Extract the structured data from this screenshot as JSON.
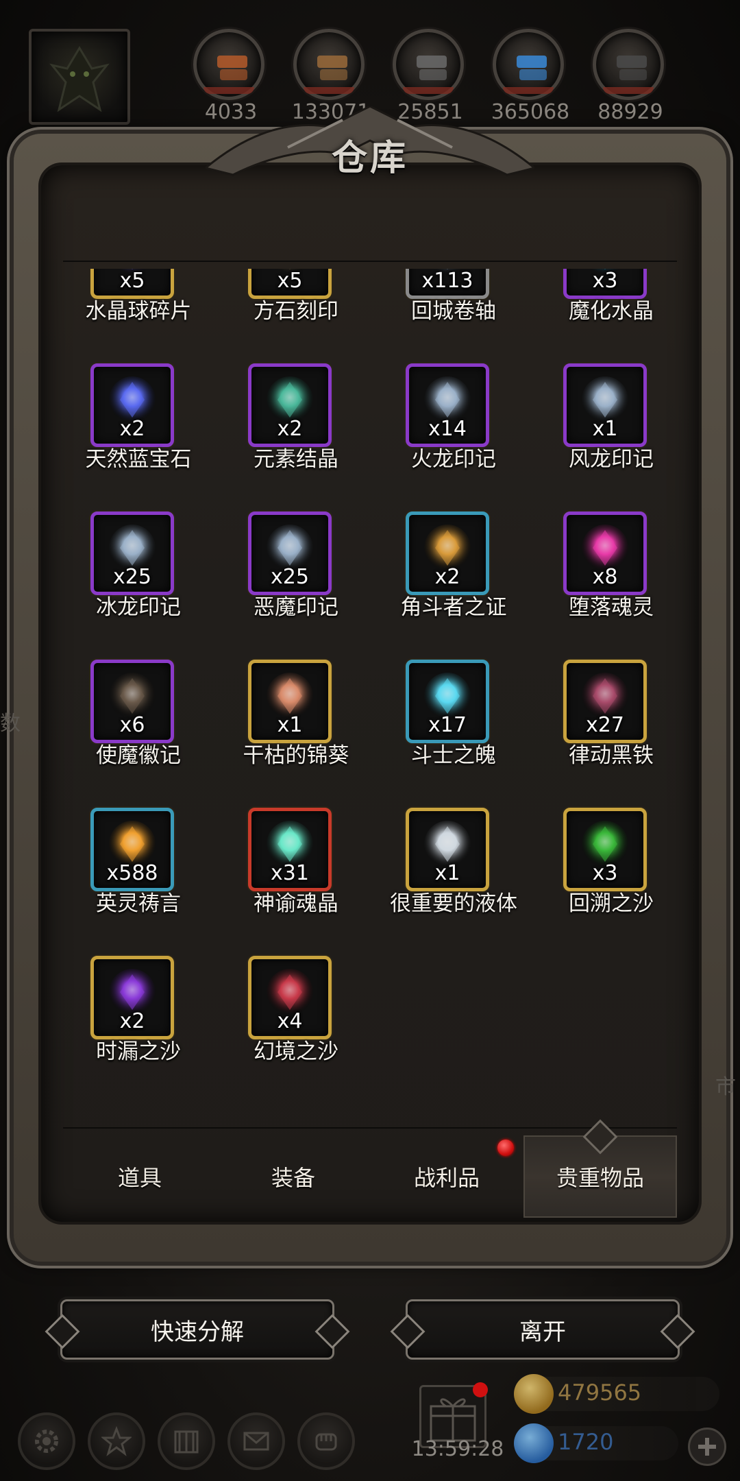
{
  "resources": [
    {
      "name": "meat-icon",
      "value": "4033",
      "color": "#b55a2a"
    },
    {
      "name": "wood-icon",
      "value": "133071",
      "color": "#9a6a3a"
    },
    {
      "name": "iron-icon",
      "value": "25851",
      "color": "#6a6a6a"
    },
    {
      "name": "crystal-icon",
      "value": "365068",
      "color": "#3a8ad8"
    },
    {
      "name": "blackiron-icon",
      "value": "88929",
      "color": "#4a4a4a"
    }
  ],
  "panel": {
    "title": "仓库"
  },
  "items": [
    {
      "name": "水晶球碎片",
      "count": "x5",
      "frame": "#c9a33e",
      "icon": "crystal-shard-icon",
      "color": "#7a6ad8"
    },
    {
      "name": "方石刻印",
      "count": "x5",
      "frame": "#c9a33e",
      "icon": "stone-seal-icon",
      "color": "#8a7a5a"
    },
    {
      "name": "回城卷轴",
      "count": "x113",
      "frame": "#8a8a8a",
      "icon": "town-scroll-icon",
      "color": "#9ab0c8"
    },
    {
      "name": "魔化水晶",
      "count": "x3",
      "frame": "#8a3ac8",
      "icon": "magic-crystal-icon",
      "color": "#3ab8e8"
    },
    {
      "name": "天然蓝宝石",
      "count": "x2",
      "frame": "#8a3ac8",
      "icon": "sapphire-icon",
      "color": "#5a6af0"
    },
    {
      "name": "元素结晶",
      "count": "x2",
      "frame": "#8a3ac8",
      "icon": "element-crystal-icon",
      "color": "#4ab89a"
    },
    {
      "name": "火龙印记",
      "count": "x14",
      "frame": "#8a3ac8",
      "icon": "fire-dragon-seal-icon",
      "color": "#9ab0c8"
    },
    {
      "name": "风龙印记",
      "count": "x1",
      "frame": "#8a3ac8",
      "icon": "wind-dragon-seal-icon",
      "color": "#9ab0c8"
    },
    {
      "name": "冰龙印记",
      "count": "x25",
      "frame": "#8a3ac8",
      "icon": "ice-dragon-seal-icon",
      "color": "#9ab0c8"
    },
    {
      "name": "恶魔印记",
      "count": "x25",
      "frame": "#8a3ac8",
      "icon": "demon-seal-icon",
      "color": "#9ab0c8"
    },
    {
      "name": "角斗者之证",
      "count": "x2",
      "frame": "#3a9ab8",
      "icon": "gladiator-badge-icon",
      "color": "#d89a3a"
    },
    {
      "name": "堕落魂灵",
      "count": "x8",
      "frame": "#8a3ac8",
      "icon": "fallen-soul-icon",
      "color": "#e83aa8"
    },
    {
      "name": "使魔徽记",
      "count": "x6",
      "frame": "#8a3ac8",
      "icon": "familiar-emblem-icon",
      "color": "#6a5a4a"
    },
    {
      "name": "干枯的锦葵",
      "count": "x1",
      "frame": "#c9a33e",
      "icon": "dried-mallow-icon",
      "color": "#d88a6a"
    },
    {
      "name": "斗士之魄",
      "count": "x17",
      "frame": "#3a9ab8",
      "icon": "fighter-spirit-icon",
      "color": "#5ad8f0"
    },
    {
      "name": "律动黑铁",
      "count": "x27",
      "frame": "#c9a33e",
      "icon": "pulse-blackiron-icon",
      "color": "#a84a6a"
    },
    {
      "name": "英灵祷言",
      "count": "x588",
      "frame": "#3a9ab8",
      "icon": "hero-prayer-icon",
      "color": "#f0a030"
    },
    {
      "name": "神谕魂晶",
      "count": "x31",
      "frame": "#c83a2a",
      "icon": "oracle-soul-crystal-icon",
      "color": "#6ae8c8"
    },
    {
      "name": "很重要的液体",
      "count": "x1",
      "frame": "#c9a33e",
      "icon": "important-liquid-icon",
      "color": "#d0d8e0"
    },
    {
      "name": "回溯之沙",
      "count": "x3",
      "frame": "#c9a33e",
      "icon": "rewind-sand-icon",
      "color": "#3ab83a"
    },
    {
      "name": "时漏之沙",
      "count": "x2",
      "frame": "#c9a33e",
      "icon": "hourglass-sand-icon",
      "color": "#8a3ad8"
    },
    {
      "name": "幻境之沙",
      "count": "x4",
      "frame": "#c9a33e",
      "icon": "illusion-sand-icon",
      "color": "#c83a4a"
    }
  ],
  "tabs": [
    {
      "label": "道具"
    },
    {
      "label": "装备"
    },
    {
      "label": "战利品"
    },
    {
      "label": "贵重物品"
    }
  ],
  "buttons": {
    "decompose": "快速分解",
    "leave": "离开"
  },
  "bottom": {
    "timer": "13:59:28",
    "gold": "479565",
    "gold_color": "#c9a33e",
    "diamond": "1720",
    "diamond_color": "#3a8ad8"
  },
  "side_text": {
    "left": "数",
    "right": "市"
  }
}
